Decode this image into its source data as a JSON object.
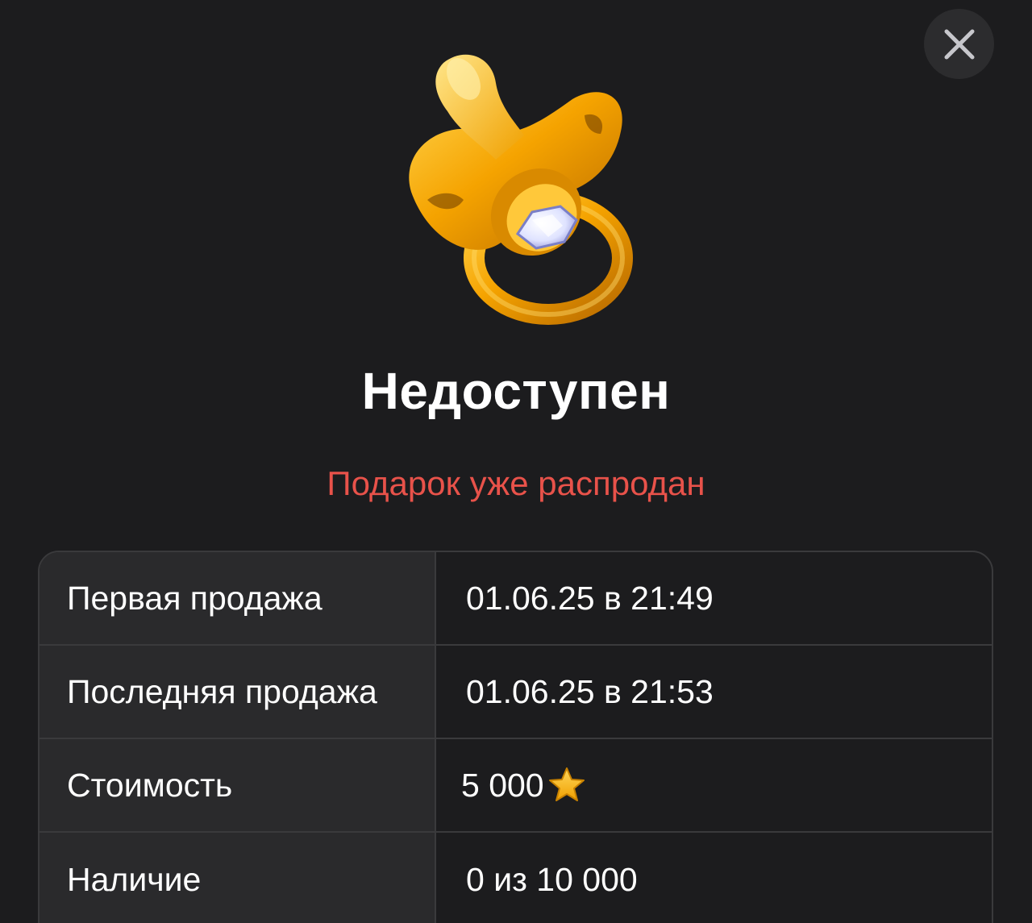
{
  "dialog": {
    "title": "Недоступен",
    "subtitle": "Подарок уже распродан",
    "close_icon": "close-icon",
    "gift_icon": "golden-pacifier-icon"
  },
  "colors": {
    "background": "#1c1c1e",
    "subtitle": "#e8524a",
    "label_cell": "#2a2a2c",
    "border": "#3a3a3c",
    "close_button": "#2c2c2e"
  },
  "details": {
    "rows": [
      {
        "label": "Первая продажа",
        "value": "01.06.25 в 21:49"
      },
      {
        "label": "Последняя продажа",
        "value": "01.06.25 в 21:53"
      },
      {
        "label": "Стоимость",
        "value": "5 000",
        "icon": "star-icon"
      },
      {
        "label": "Наличие",
        "value": "0 из 10 000"
      }
    ]
  }
}
